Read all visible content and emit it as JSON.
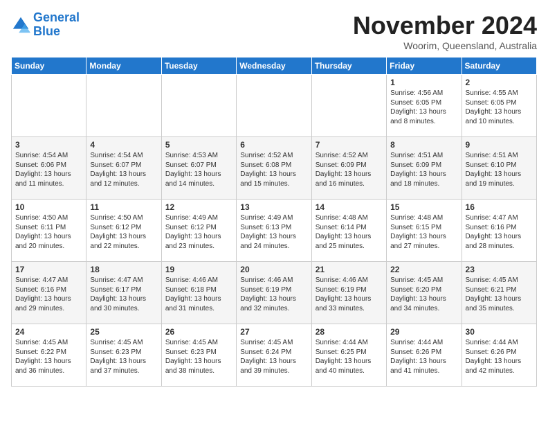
{
  "header": {
    "logo_line1": "General",
    "logo_line2": "Blue",
    "month_title": "November 2024",
    "location": "Woorim, Queensland, Australia"
  },
  "weekdays": [
    "Sunday",
    "Monday",
    "Tuesday",
    "Wednesday",
    "Thursday",
    "Friday",
    "Saturday"
  ],
  "weeks": [
    [
      {
        "day": "",
        "info": ""
      },
      {
        "day": "",
        "info": ""
      },
      {
        "day": "",
        "info": ""
      },
      {
        "day": "",
        "info": ""
      },
      {
        "day": "",
        "info": ""
      },
      {
        "day": "1",
        "info": "Sunrise: 4:56 AM\nSunset: 6:05 PM\nDaylight: 13 hours and 8 minutes."
      },
      {
        "day": "2",
        "info": "Sunrise: 4:55 AM\nSunset: 6:05 PM\nDaylight: 13 hours and 10 minutes."
      }
    ],
    [
      {
        "day": "3",
        "info": "Sunrise: 4:54 AM\nSunset: 6:06 PM\nDaylight: 13 hours and 11 minutes."
      },
      {
        "day": "4",
        "info": "Sunrise: 4:54 AM\nSunset: 6:07 PM\nDaylight: 13 hours and 12 minutes."
      },
      {
        "day": "5",
        "info": "Sunrise: 4:53 AM\nSunset: 6:07 PM\nDaylight: 13 hours and 14 minutes."
      },
      {
        "day": "6",
        "info": "Sunrise: 4:52 AM\nSunset: 6:08 PM\nDaylight: 13 hours and 15 minutes."
      },
      {
        "day": "7",
        "info": "Sunrise: 4:52 AM\nSunset: 6:09 PM\nDaylight: 13 hours and 16 minutes."
      },
      {
        "day": "8",
        "info": "Sunrise: 4:51 AM\nSunset: 6:09 PM\nDaylight: 13 hours and 18 minutes."
      },
      {
        "day": "9",
        "info": "Sunrise: 4:51 AM\nSunset: 6:10 PM\nDaylight: 13 hours and 19 minutes."
      }
    ],
    [
      {
        "day": "10",
        "info": "Sunrise: 4:50 AM\nSunset: 6:11 PM\nDaylight: 13 hours and 20 minutes."
      },
      {
        "day": "11",
        "info": "Sunrise: 4:50 AM\nSunset: 6:12 PM\nDaylight: 13 hours and 22 minutes."
      },
      {
        "day": "12",
        "info": "Sunrise: 4:49 AM\nSunset: 6:12 PM\nDaylight: 13 hours and 23 minutes."
      },
      {
        "day": "13",
        "info": "Sunrise: 4:49 AM\nSunset: 6:13 PM\nDaylight: 13 hours and 24 minutes."
      },
      {
        "day": "14",
        "info": "Sunrise: 4:48 AM\nSunset: 6:14 PM\nDaylight: 13 hours and 25 minutes."
      },
      {
        "day": "15",
        "info": "Sunrise: 4:48 AM\nSunset: 6:15 PM\nDaylight: 13 hours and 27 minutes."
      },
      {
        "day": "16",
        "info": "Sunrise: 4:47 AM\nSunset: 6:16 PM\nDaylight: 13 hours and 28 minutes."
      }
    ],
    [
      {
        "day": "17",
        "info": "Sunrise: 4:47 AM\nSunset: 6:16 PM\nDaylight: 13 hours and 29 minutes."
      },
      {
        "day": "18",
        "info": "Sunrise: 4:47 AM\nSunset: 6:17 PM\nDaylight: 13 hours and 30 minutes."
      },
      {
        "day": "19",
        "info": "Sunrise: 4:46 AM\nSunset: 6:18 PM\nDaylight: 13 hours and 31 minutes."
      },
      {
        "day": "20",
        "info": "Sunrise: 4:46 AM\nSunset: 6:19 PM\nDaylight: 13 hours and 32 minutes."
      },
      {
        "day": "21",
        "info": "Sunrise: 4:46 AM\nSunset: 6:19 PM\nDaylight: 13 hours and 33 minutes."
      },
      {
        "day": "22",
        "info": "Sunrise: 4:45 AM\nSunset: 6:20 PM\nDaylight: 13 hours and 34 minutes."
      },
      {
        "day": "23",
        "info": "Sunrise: 4:45 AM\nSunset: 6:21 PM\nDaylight: 13 hours and 35 minutes."
      }
    ],
    [
      {
        "day": "24",
        "info": "Sunrise: 4:45 AM\nSunset: 6:22 PM\nDaylight: 13 hours and 36 minutes."
      },
      {
        "day": "25",
        "info": "Sunrise: 4:45 AM\nSunset: 6:23 PM\nDaylight: 13 hours and 37 minutes."
      },
      {
        "day": "26",
        "info": "Sunrise: 4:45 AM\nSunset: 6:23 PM\nDaylight: 13 hours and 38 minutes."
      },
      {
        "day": "27",
        "info": "Sunrise: 4:45 AM\nSunset: 6:24 PM\nDaylight: 13 hours and 39 minutes."
      },
      {
        "day": "28",
        "info": "Sunrise: 4:44 AM\nSunset: 6:25 PM\nDaylight: 13 hours and 40 minutes."
      },
      {
        "day": "29",
        "info": "Sunrise: 4:44 AM\nSunset: 6:26 PM\nDaylight: 13 hours and 41 minutes."
      },
      {
        "day": "30",
        "info": "Sunrise: 4:44 AM\nSunset: 6:26 PM\nDaylight: 13 hours and 42 minutes."
      }
    ]
  ]
}
